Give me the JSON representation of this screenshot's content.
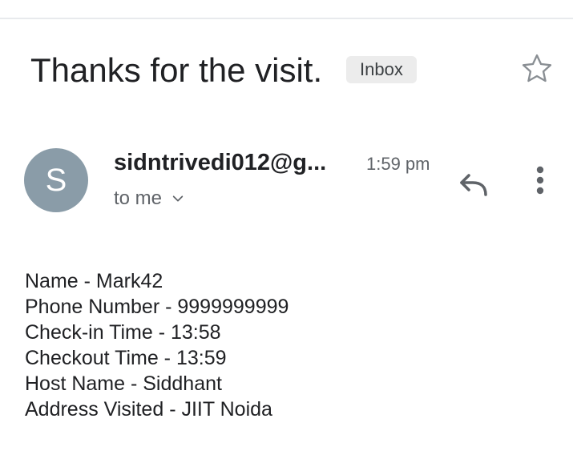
{
  "email": {
    "subject": "Thanks for the visit.",
    "label": "Inbox",
    "star_icon": "star-outline-icon",
    "sender": {
      "avatar_letter": "S",
      "avatar_color": "#8a9ca8",
      "address": "sidntrivedi012@g...",
      "time": "1:59 pm",
      "recipient": "to me"
    },
    "actions": {
      "reply_icon": "reply-icon",
      "more_icon": "more-vert-icon",
      "expand_icon": "chevron-down-icon"
    },
    "body_lines": [
      "Name - Mark42",
      "Phone Number - 9999999999",
      "Check-in Time - 13:58",
      "Checkout Time - 13:59",
      "Host Name - Siddhant",
      "Address Visited - JIIT Noida"
    ]
  }
}
